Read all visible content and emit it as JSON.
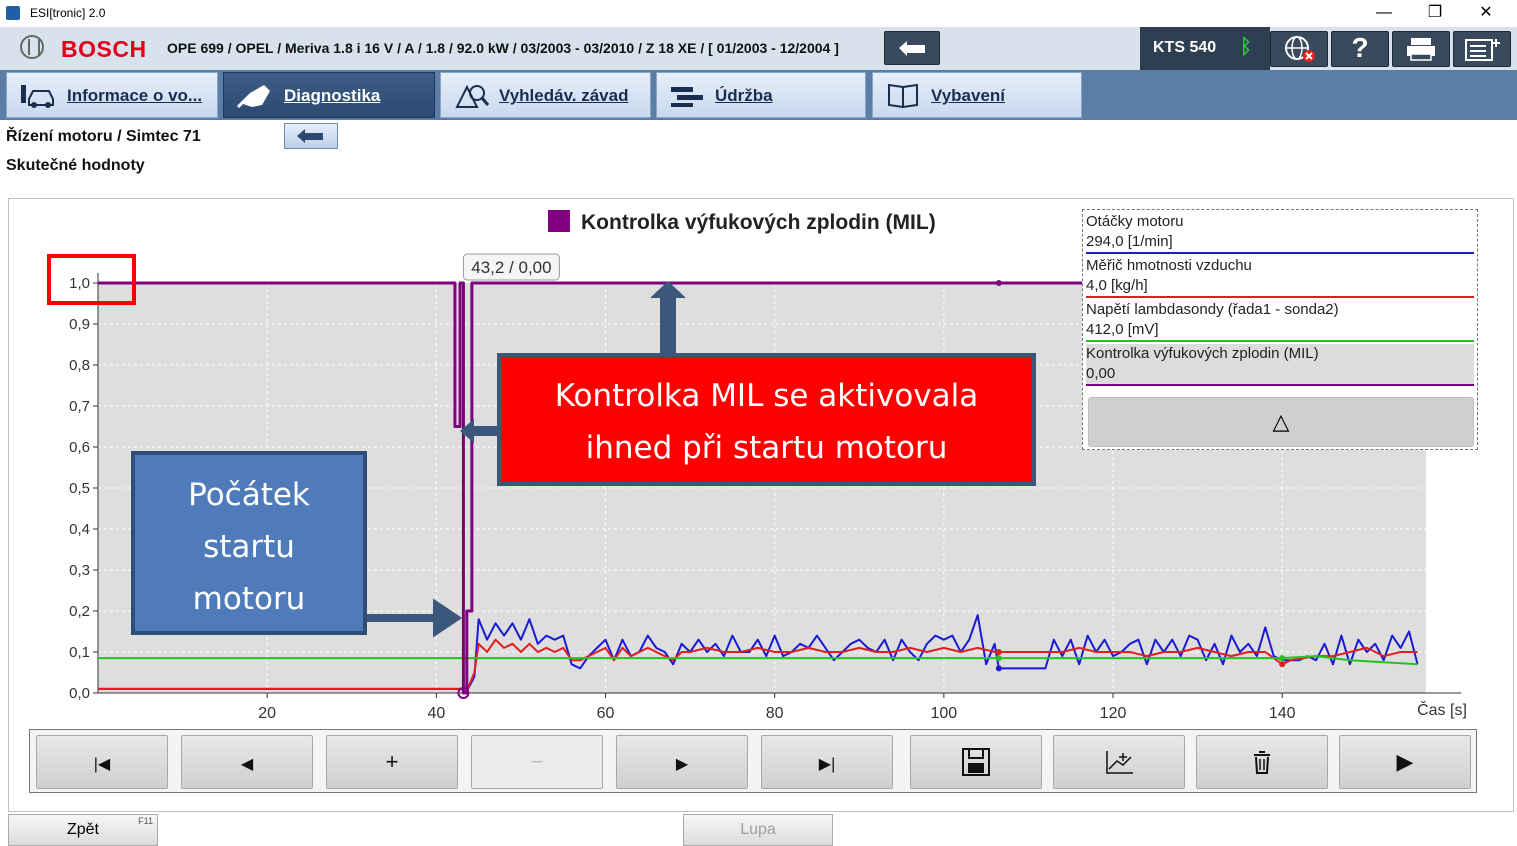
{
  "window": {
    "title": "ESI[tronic] 2.0",
    "minimize": "—",
    "restore": "❐",
    "close": "✕"
  },
  "header": {
    "brand": "BOSCH",
    "vehicle": "OPE 699 / OPEL / Meriva 1.8 i 16 V / A / 1.8 / 92.0 kW / 03/2003 - 03/2010 / Z 18 XE / [ 01/2003 - 12/2004 ]",
    "device": "KTS 540",
    "bluetooth_icon": "ᛒ",
    "help": "?"
  },
  "tabs": [
    {
      "label": "Informace o vo...",
      "active": false
    },
    {
      "label": "Diagnostika",
      "active": true
    },
    {
      "label": "Vyhledáv. závad",
      "active": false
    },
    {
      "label": "Údržba",
      "active": false
    },
    {
      "label": "Vybavení",
      "active": false
    }
  ],
  "breadcrumb": "Řízení motoru / Simtec 71",
  "subtitle": "Skutečné hodnoty",
  "chart_data": {
    "type": "line",
    "title": "Kontrolka výfukových zplodin (MIL)",
    "xlabel": "Čas [s]",
    "ylabel": "",
    "xlim": [
      0,
      157
    ],
    "ylim": [
      0,
      1.0
    ],
    "x_ticks": [
      20,
      40,
      60,
      80,
      100,
      120,
      140
    ],
    "y_ticks": [
      "0,0",
      "0,1",
      "0,2",
      "0,3",
      "0,4",
      "0,5",
      "0,6",
      "0,7",
      "0,8",
      "0,9",
      "1,0"
    ],
    "cursor_label": "43,2 / 0,00",
    "cursor_x": 43.2,
    "grid": true,
    "series": [
      {
        "name": "Otáčky motoru",
        "color": "#1a1ad6",
        "x": [
          0,
          43,
          43.5,
          44.5,
          45,
          46,
          47,
          48,
          49,
          50,
          51,
          52,
          53,
          54,
          55,
          56,
          57,
          58,
          59,
          60,
          61,
          62,
          63,
          64,
          65,
          66,
          67,
          68,
          69,
          70,
          71,
          72,
          73,
          74,
          75,
          76,
          77,
          78,
          79,
          80,
          81,
          82,
          83,
          84,
          85,
          86,
          87,
          88,
          89,
          90,
          91,
          92,
          93,
          94,
          95,
          96,
          97,
          98,
          99,
          100,
          101,
          102,
          103,
          104,
          105,
          106,
          106.5,
          112,
          113,
          114,
          115,
          116,
          117,
          118,
          119,
          120,
          121,
          122,
          123,
          124,
          125,
          126,
          127,
          128,
          129,
          130,
          131,
          132,
          133,
          134,
          135,
          136,
          137,
          138,
          139,
          140,
          141,
          142,
          143,
          144,
          145,
          146,
          147,
          148,
          149,
          150,
          151,
          152,
          153,
          154,
          155,
          156
        ],
        "y": [
          0.01,
          0.01,
          0.0,
          0.04,
          0.18,
          0.13,
          0.17,
          0.14,
          0.17,
          0.13,
          0.18,
          0.12,
          0.14,
          0.13,
          0.14,
          0.07,
          0.06,
          0.09,
          0.11,
          0.13,
          0.08,
          0.13,
          0.09,
          0.1,
          0.14,
          0.11,
          0.1,
          0.07,
          0.12,
          0.1,
          0.13,
          0.1,
          0.12,
          0.09,
          0.14,
          0.1,
          0.1,
          0.13,
          0.09,
          0.14,
          0.09,
          0.1,
          0.12,
          0.11,
          0.14,
          0.11,
          0.08,
          0.1,
          0.12,
          0.13,
          0.11,
          0.1,
          0.13,
          0.08,
          0.13,
          0.1,
          0.08,
          0.12,
          0.14,
          0.13,
          0.14,
          0.1,
          0.13,
          0.19,
          0.07,
          0.12,
          0.06,
          0.06,
          0.13,
          0.09,
          0.13,
          0.07,
          0.14,
          0.1,
          0.13,
          0.09,
          0.1,
          0.12,
          0.13,
          0.07,
          0.13,
          0.1,
          0.13,
          0.09,
          0.14,
          0.13,
          0.08,
          0.12,
          0.07,
          0.14,
          0.1,
          0.12,
          0.09,
          0.16,
          0.09,
          0.08,
          0.08,
          0.08,
          0.09,
          0.08,
          0.12,
          0.07,
          0.14,
          0.07,
          0.13,
          0.1,
          0.12,
          0.08,
          0.14,
          0.11,
          0.15,
          0.07
        ]
      },
      {
        "name": "Měřič hmotnosti vzduchu",
        "color": "#e02020",
        "x": [
          0,
          43,
          43.5,
          44.5,
          45,
          46,
          47,
          48,
          49,
          50,
          51,
          52,
          53,
          54,
          55,
          56,
          57,
          58,
          59,
          60,
          61,
          62,
          63,
          64,
          65,
          66,
          67,
          68,
          69,
          70,
          72,
          74,
          76,
          78,
          80,
          82,
          84,
          86,
          88,
          90,
          92,
          94,
          96,
          98,
          100,
          102,
          104,
          106,
          106.5,
          112,
          114,
          116,
          118,
          120,
          122,
          124,
          126,
          128,
          130,
          132,
          134,
          136,
          138,
          140,
          141,
          144,
          146,
          148,
          150,
          152,
          154,
          156
        ],
        "y": [
          0.01,
          0.01,
          0.0,
          0.05,
          0.12,
          0.1,
          0.13,
          0.11,
          0.12,
          0.1,
          0.12,
          0.1,
          0.11,
          0.1,
          0.11,
          0.08,
          0.08,
          0.09,
          0.1,
          0.11,
          0.08,
          0.11,
          0.09,
          0.1,
          0.11,
          0.1,
          0.09,
          0.08,
          0.1,
          0.1,
          0.11,
          0.1,
          0.1,
          0.11,
          0.1,
          0.1,
          0.11,
          0.1,
          0.1,
          0.11,
          0.1,
          0.1,
          0.11,
          0.1,
          0.11,
          0.1,
          0.11,
          0.1,
          0.1,
          0.1,
          0.1,
          0.11,
          0.1,
          0.1,
          0.1,
          0.09,
          0.1,
          0.1,
          0.11,
          0.1,
          0.09,
          0.1,
          0.1,
          0.07,
          0.08,
          0.09,
          0.09,
          0.1,
          0.11,
          0.09,
          0.1,
          0.1
        ]
      },
      {
        "name": "Napětí lambdasondy (řada1 - sonda2)",
        "color": "#22c422",
        "x": [
          0,
          20,
          40,
          43,
          44,
          60,
          80,
          100,
          106,
          120,
          130,
          140,
          144,
          148,
          152,
          156
        ],
        "y": [
          0.085,
          0.085,
          0.085,
          0.085,
          0.085,
          0.085,
          0.085,
          0.085,
          0.085,
          0.085,
          0.085,
          0.085,
          0.09,
          0.08,
          0.075,
          0.07
        ]
      },
      {
        "name": "Kontrolka výfukových zplodin (MIL)",
        "color": "#800080",
        "x": [
          0,
          42.2,
          42.2,
          42.8,
          42.8,
          43.2,
          43.2,
          43.6,
          43.6,
          44.2,
          44.2,
          106.5,
          157
        ],
        "y": [
          1,
          1,
          0.65,
          0.65,
          1,
          1,
          0,
          0,
          0.2,
          0.2,
          1,
          1,
          1
        ]
      }
    ]
  },
  "legend": [
    {
      "name": "Otáčky motoru",
      "value": "294,0 [1/min]",
      "color": "#1a1ad6"
    },
    {
      "name": "Měřič hmotnosti vzduchu",
      "value": "4,0 [kg/h]",
      "color": "#e02020"
    },
    {
      "name": "Napětí lambdasondy (řada1 - sonda2)",
      "value": "412,0 [mV]",
      "color": "#22c422"
    },
    {
      "name": "Kontrolka výfukových zplodin (MIL)",
      "value": "0,00",
      "color": "#800080"
    }
  ],
  "legend_toggle": "△",
  "controls": [
    "|◀",
    "◀",
    "+",
    "−",
    "▶",
    "▶|",
    "save",
    "chart-settings",
    "delete",
    "▶"
  ],
  "annotations": {
    "red_box": [
      "Kontrolka MIL se aktivovala",
      "ihned při startu motoru"
    ],
    "blue_box": [
      "Počátek",
      "startu",
      "motoru"
    ]
  },
  "footer": {
    "back": "Zpět",
    "back_key": "F11",
    "zoom": "Lupa"
  }
}
